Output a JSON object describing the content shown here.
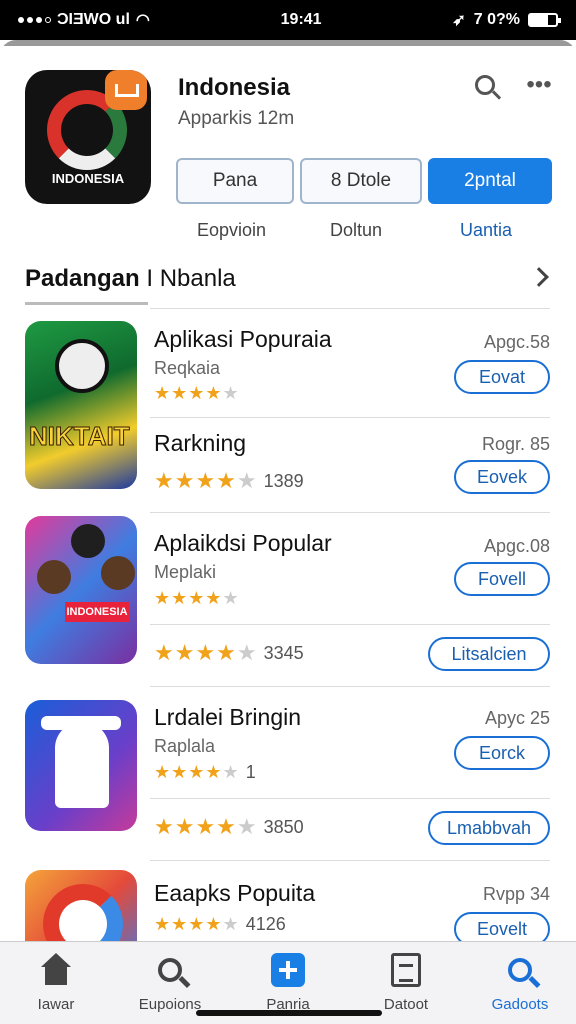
{
  "status_bar": {
    "carrier": "ƆIƎWO ul",
    "time": "19:41",
    "battery": "7 0?%",
    "signal_icon": "signal-dots-icon",
    "wifi_icon": "wifi-icon",
    "location_icon": "location-icon",
    "battery_icon": "battery-icon"
  },
  "header": {
    "title": "Indonesia",
    "subtitle": "Apparkis 12m",
    "icon_label": "INDONESIA",
    "search_icon": "search-icon",
    "more_icon": "more-icon"
  },
  "segments": [
    {
      "label": "Pana",
      "caption": "Eopvioin"
    },
    {
      "label": "8 Dtole",
      "caption": "Doltun"
    },
    {
      "label": "2pntal",
      "caption": "Uantia"
    }
  ],
  "section": {
    "title_bold": "Padangan",
    "title_rest": " I Nbanla"
  },
  "rows": [
    {
      "title": "Aplikasi Popuraia",
      "subtitle": "Reqkaia",
      "meta": "Apgc.58",
      "button": "Eovat",
      "stars": "★★★★★",
      "rating_count": ""
    },
    {
      "title": "Rarkning",
      "subtitle": "",
      "meta": "Rogr. 85",
      "button": "Eovek",
      "stars": "★★★★★",
      "rating_count": "1389"
    },
    {
      "title": "Aplaikdsi Popular",
      "subtitle": "Meplaki",
      "meta": "Apgc.08",
      "button": "Fovell",
      "stars": "★★★★★",
      "rating_count": ""
    },
    {
      "title": "",
      "subtitle": "",
      "meta": "",
      "button": "Litsalcien",
      "stars": "★★★★★",
      "rating_count": "3345"
    },
    {
      "title": "Lrdalei Bringin",
      "subtitle": "Raplala",
      "meta": "Apyc 25",
      "button": "Eorck",
      "stars": "★★★★★",
      "rating_count": "1"
    },
    {
      "title": "",
      "subtitle": "",
      "meta": "",
      "button": "Lmabbvah",
      "stars": "★★★★★",
      "rating_count": "3850"
    },
    {
      "title": "Eaapks Popuita",
      "subtitle": "",
      "meta": "Rvpp 34",
      "button": "Eovelt",
      "stars": "★★★★★",
      "rating_count": "4126"
    }
  ],
  "thumbs": {
    "game_text": "NIKTAIT",
    "people_banner": "INDONESIA"
  },
  "tabbar": [
    {
      "label": "Iawar",
      "icon": "home-icon"
    },
    {
      "label": "Eupoions",
      "icon": "search-icon"
    },
    {
      "label": "Panria",
      "icon": "plus-icon"
    },
    {
      "label": "Datoot",
      "icon": "document-icon"
    },
    {
      "label": "Gadoots",
      "icon": "search-icon"
    }
  ]
}
